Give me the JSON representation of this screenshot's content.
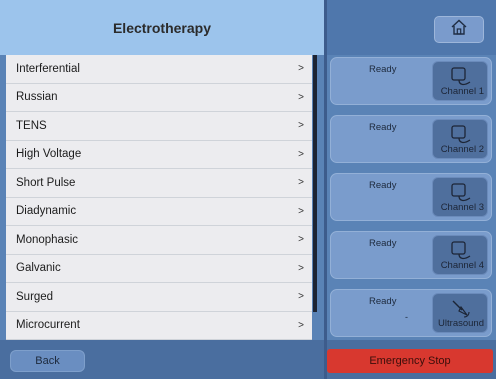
{
  "header": {
    "title": "Electrotherapy"
  },
  "menu": {
    "chevron": ">",
    "items": [
      {
        "label": "Interferential"
      },
      {
        "label": "Russian"
      },
      {
        "label": "TENS"
      },
      {
        "label": "High Voltage"
      },
      {
        "label": "Short Pulse"
      },
      {
        "label": "Diadynamic"
      },
      {
        "label": "Monophasic"
      },
      {
        "label": "Galvanic"
      },
      {
        "label": "Surged"
      },
      {
        "label": "Microcurrent"
      }
    ]
  },
  "footer": {
    "back_label": "Back",
    "emergency_label": "Emergency Stop"
  },
  "home": {
    "icon": "home-icon"
  },
  "channels": [
    {
      "status": "Ready",
      "label": "Channel 1",
      "icon": "electrode-icon"
    },
    {
      "status": "Ready",
      "label": "Channel 2",
      "icon": "electrode-icon"
    },
    {
      "status": "Ready",
      "label": "Channel 3",
      "icon": "electrode-icon"
    },
    {
      "status": "Ready",
      "label": "Channel 4",
      "icon": "electrode-icon"
    },
    {
      "status": "Ready",
      "extra": "-",
      "label": "Ultrasound",
      "icon": "ultrasound-head-icon"
    }
  ],
  "colors": {
    "header": "#9cc4ec",
    "panel": "#5a83b6",
    "card": "#7a9ccc",
    "emergency": "#d8382f"
  }
}
